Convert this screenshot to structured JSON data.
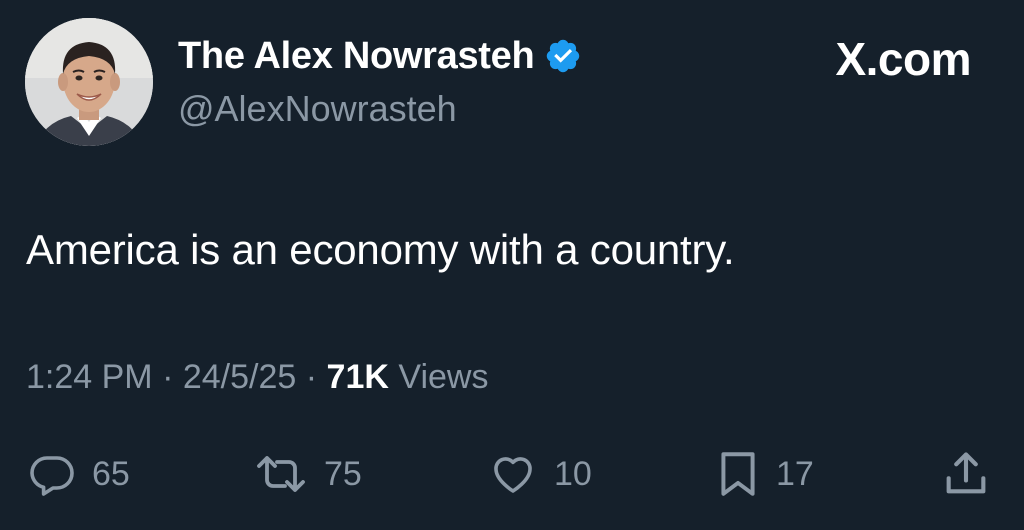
{
  "author": {
    "display_name": "The Alex Nowrasteh",
    "handle": "@AlexNowrasteh",
    "verified_icon": "verified-badge-icon",
    "verified_color": "#1d9bf0"
  },
  "brand": "X.com",
  "tweet": {
    "text": "America is an economy with a country."
  },
  "meta": {
    "time": "1:24 PM",
    "sep1": "·",
    "date": "24/5/25",
    "sep2": "·",
    "views_count": "71K",
    "views_label": "Views"
  },
  "actions": {
    "replies": {
      "icon": "reply-icon",
      "count": "65"
    },
    "reposts": {
      "icon": "repost-icon",
      "count": "75"
    },
    "likes": {
      "icon": "heart-icon",
      "count": "10"
    },
    "bookmarks": {
      "icon": "bookmark-icon",
      "count": "17"
    },
    "share": {
      "icon": "share-icon"
    }
  },
  "colors": {
    "background": "#15202b",
    "primary_text": "#ffffff",
    "secondary_text": "#8b98a5",
    "accent": "#1d9bf0"
  }
}
